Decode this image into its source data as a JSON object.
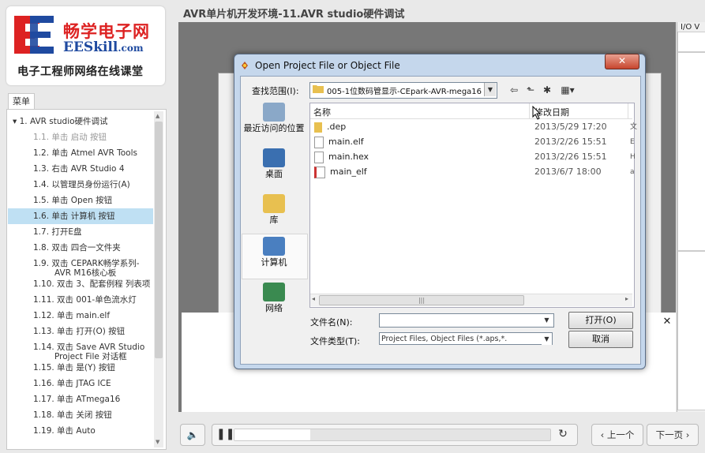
{
  "logo": {
    "cn_name": "畅学电子网",
    "en_name_main": "EESkill",
    "en_name_suffix": ".com",
    "subtitle": "电子工程师网络在线课堂"
  },
  "menu": {
    "tab_label": "菜单",
    "items": [
      {
        "label": "▾ 1. AVR studio硬件调试",
        "state": "normal"
      },
      {
        "label": "1.1. 单击 启动 按钮",
        "state": "dim"
      },
      {
        "label": "1.2. 单击 Atmel AVR Tools",
        "state": "normal"
      },
      {
        "label": "1.3. 右击 AVR Studio 4",
        "state": "normal"
      },
      {
        "label": "1.4. 以管理员身份运行(A)",
        "state": "normal"
      },
      {
        "label": "1.5. 单击 Open 按钮",
        "state": "normal"
      },
      {
        "label": "1.6. 单击 计算机 按钮",
        "state": "selected"
      },
      {
        "label": "1.7. 打开E盘",
        "state": "normal"
      },
      {
        "label": "1.8. 双击 四合一文件夹",
        "state": "normal"
      },
      {
        "label": "1.9. 双击 CEPARK畅学系列-",
        "label2": "AVR M16核心板",
        "state": "normal"
      },
      {
        "label": "1.10. 双击 3、配套例程 列表项",
        "state": "normal"
      },
      {
        "label": "1.11. 双击 001-单色流水灯",
        "state": "normal"
      },
      {
        "label": "1.12. 单击 main.elf",
        "state": "normal"
      },
      {
        "label": "1.13. 单击 打开(O) 按钮",
        "state": "normal"
      },
      {
        "label": "1.14. 双击 Save AVR Studio",
        "label2": "Project File 对话框",
        "state": "normal"
      },
      {
        "label": "1.15. 单击 是(Y) 按钮",
        "state": "normal"
      },
      {
        "label": "1.16. 单击 JTAG ICE",
        "state": "normal"
      },
      {
        "label": "1.17. 单击 ATmega16",
        "state": "normal"
      },
      {
        "label": "1.18. 单击 关闭 按钮",
        "state": "normal"
      },
      {
        "label": "1.19. 单击 Auto",
        "state": "normal"
      }
    ]
  },
  "header": {
    "title": "AVR单片机开发环境-11.AVR studio硬件调试"
  },
  "side_strip": {
    "label": "I/O V"
  },
  "dialog": {
    "title": "Open Project File or Object File",
    "close_label": "✕",
    "look_in_label": "查找范围(I):",
    "look_in_value": "005-1位数码管显示-CEpark-AVR-mega16-",
    "places": [
      {
        "label": "最近访问的位置",
        "icon": "recent-places-icon"
      },
      {
        "label": "桌面",
        "icon": "desktop-icon"
      },
      {
        "label": "库",
        "icon": "libraries-icon"
      },
      {
        "label": "计算机",
        "icon": "computer-icon"
      },
      {
        "label": "网络",
        "icon": "network-icon"
      }
    ],
    "columns": {
      "name": "名称",
      "date": "修改日期"
    },
    "files": [
      {
        "name": ".dep",
        "date": "2013/5/29 17:20",
        "ext": "文",
        "icon": "folder-icon"
      },
      {
        "name": "main.elf",
        "date": "2013/2/26 15:51",
        "ext": "E",
        "icon": "file-icon"
      },
      {
        "name": "main.hex",
        "date": "2013/2/26 15:51",
        "ext": "H",
        "icon": "file-icon"
      },
      {
        "name": "main_elf",
        "date": "2013/6/7 18:00",
        "ext": "a",
        "icon": "app-file-icon"
      }
    ],
    "filename_label": "文件名(N):",
    "filename_value": "",
    "filetype_label": "文件类型(T):",
    "filetype_value": "Project Files, Object Files (*.aps,*.",
    "open_button": "打开(O)",
    "cancel_button": "取消"
  },
  "player": {
    "progress": 0.24,
    "prev_label": "‹ 上一个",
    "next_label": "下一页 ›"
  },
  "colors": {
    "logo_red": "#d22222",
    "logo_blue": "#1f4aa0",
    "menu_selected": "#bfe0f3",
    "dialog_frame": "#c5d7ec"
  }
}
